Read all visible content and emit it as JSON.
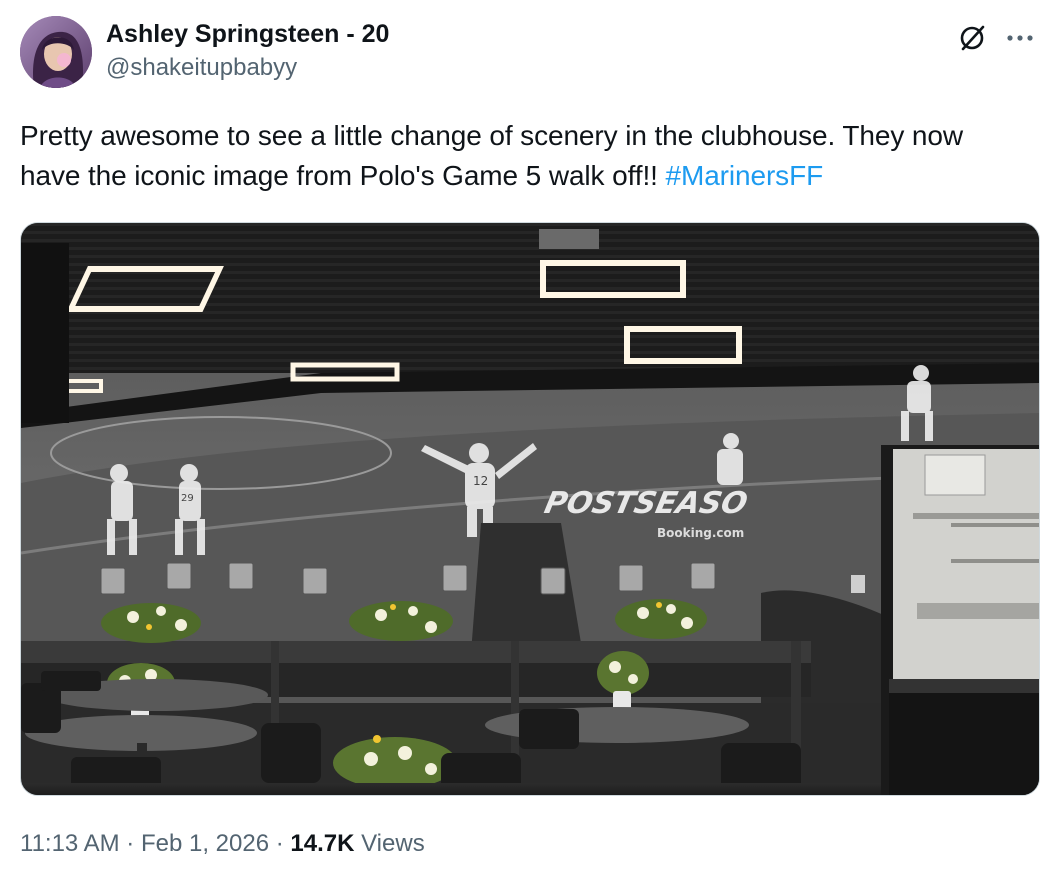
{
  "author": {
    "display_name": "Ashley Springsteen - 20",
    "handle": "@shakeitupbabyy"
  },
  "tweet": {
    "text_main": "Pretty awesome to see a little change of scenery in the clubhouse. They now have the iconic image from Polo's Game 5 walk off!! ",
    "hashtag": "#MarinersFF"
  },
  "media": {
    "mural_sign_text": "POSTSEASO",
    "mural_sub_text": "Booking.com",
    "jersey_numbers": [
      "12",
      "29"
    ]
  },
  "meta": {
    "time": "11:13 AM",
    "separator": " · ",
    "date": "Feb 1, 2026",
    "views_count": "14.7K",
    "views_label": "Views"
  },
  "icons": {
    "grok": "grok-icon",
    "more": "more-icon",
    "avatar": "avatar"
  },
  "colors": {
    "hashtag": "#1d9bf0",
    "secondary_text": "#536471",
    "primary_text": "#0f1419"
  }
}
